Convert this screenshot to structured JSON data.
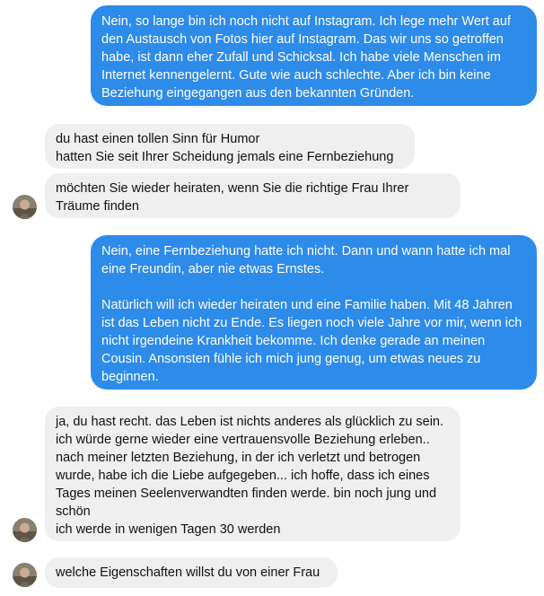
{
  "messages": [
    {
      "id": "m1",
      "sender": "me",
      "text": "Nein, so lange bin ich noch nicht auf Instagram. Ich lege mehr Wert auf den Austausch von Fotos hier auf Instagram. Das wir uns so getroffen habe, ist dann eher Zufall und Schicksal. Ich habe viele Menschen im Internet kennengelernt. Gute wie auch schlechte. Aber ich bin keine Beziehung eingegangen aus den bekannten Gründen."
    },
    {
      "id": "m2",
      "sender": "contact",
      "text": "du hast einen tollen Sinn für Humor\nhatten Sie seit Ihrer Scheidung jemals eine Fernbeziehung"
    },
    {
      "id": "m3",
      "sender": "contact",
      "text": "möchten Sie wieder heiraten, wenn Sie die richtige Frau Ihrer Träume finden"
    },
    {
      "id": "m4",
      "sender": "me",
      "text": "Nein, eine Fernbeziehung hatte ich nicht. Dann und wann hatte ich mal eine Freundin, aber nie etwas Ernstes.\n\nNatürlich will ich wieder heiraten und eine Familie haben. Mit 48 Jahren ist das Leben nicht zu Ende. Es liegen noch viele Jahre vor mir, wenn ich nicht irgendeine Krankheit bekomme. Ich denke gerade an meinen Cousin. Ansonsten fühle ich mich jung genug, um etwas neues zu beginnen."
    },
    {
      "id": "m5",
      "sender": "contact",
      "text": "ja, du hast recht. das Leben ist nichts anderes als glücklich zu sein. ich würde gerne wieder eine vertrauensvolle Beziehung erleben.. nach meiner letzten Beziehung, in der ich verletzt und betrogen wurde, habe ich die Liebe aufgegeben... ich hoffe, dass ich eines Tages meinen Seelenverwandten finden werde. bin noch jung und schön\nich werde in wenigen Tagen 30 werden"
    },
    {
      "id": "m6",
      "sender": "contact",
      "text": "welche Eigenschaften willst du von einer Frau"
    }
  ],
  "colors": {
    "outgoing_bubble": "#2d8bea",
    "incoming_bubble": "#efefef",
    "outgoing_text": "#ffffff",
    "incoming_text": "#111111"
  },
  "icons": {
    "contact_avatar": "contact-avatar-photo"
  }
}
